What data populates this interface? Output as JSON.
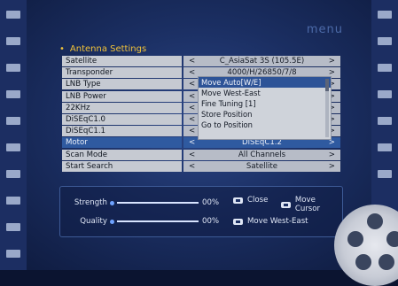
{
  "brand": "menu",
  "section_title": "Antenna Settings",
  "rows": [
    {
      "label": "Satellite",
      "value": "C_AsiaSat 3S (105.5E)"
    },
    {
      "label": "Transponder",
      "value": "4000/H/26850/7/8"
    },
    {
      "label": "LNB Type",
      "value": ""
    },
    {
      "label": "LNB Power",
      "value": ""
    },
    {
      "label": "22KHz",
      "value": ""
    },
    {
      "label": "DiSEqC1.0",
      "value": ""
    },
    {
      "label": "DiSEqC1.1",
      "value": ""
    },
    {
      "label": "Motor",
      "value": "DiSEqC1.2"
    },
    {
      "label": "Scan Mode",
      "value": "All Channels"
    },
    {
      "label": "Start Search",
      "value": "Satellite"
    }
  ],
  "selected_row": "Motor",
  "popup": {
    "items": [
      "Move Auto[W/E]",
      "Move West-East",
      "Fine Tuning [1]",
      "Store Position",
      "Go to Position"
    ],
    "highlighted": "Move Auto[W/E]"
  },
  "signal": {
    "strength": {
      "label": "Strength",
      "value": "00%"
    },
    "quality": {
      "label": "Quality",
      "value": "00%"
    }
  },
  "help": {
    "close": "Close",
    "move_cursor": "Move Cursor",
    "move_west_east": "Move West-East"
  },
  "colors": {
    "accent_title": "#f0c23a",
    "selected_row": "#2f5aa0",
    "background": "#1b2f63"
  }
}
